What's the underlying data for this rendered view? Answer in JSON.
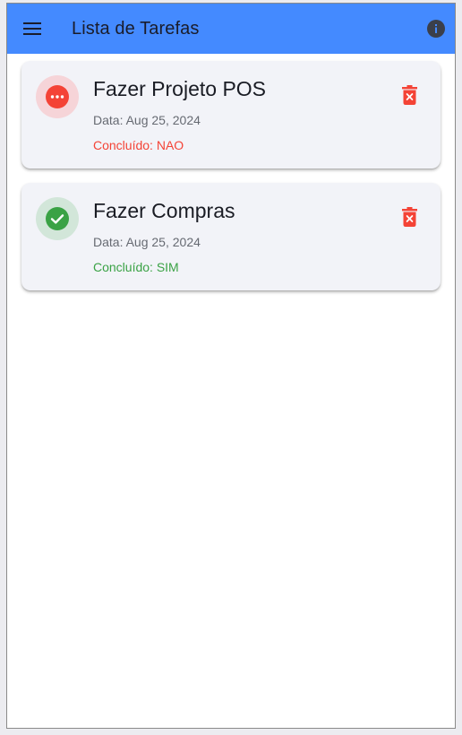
{
  "appbar": {
    "title": "Lista de Tarefas",
    "menu_icon": "menu-icon",
    "info_icon": "info-icon",
    "background": "#448aff"
  },
  "tasks": [
    {
      "title": "Fazer Projeto POS",
      "date_prefix": "Data: ",
      "date": "Aug 25, 2024",
      "status_prefix": "Concluído: ",
      "status": "NAO",
      "done": false,
      "icon": "more-horiz-icon",
      "status_color": "#f44336"
    },
    {
      "title": "Fazer Compras",
      "date_prefix": "Data: ",
      "date": "Aug 25, 2024",
      "status_prefix": "Concluído: ",
      "status": "SIM",
      "done": true,
      "icon": "check-circle-icon",
      "status_color": "#3aa245"
    }
  ],
  "delete_icon": "delete-forever-icon",
  "delete_color": "#f44336"
}
